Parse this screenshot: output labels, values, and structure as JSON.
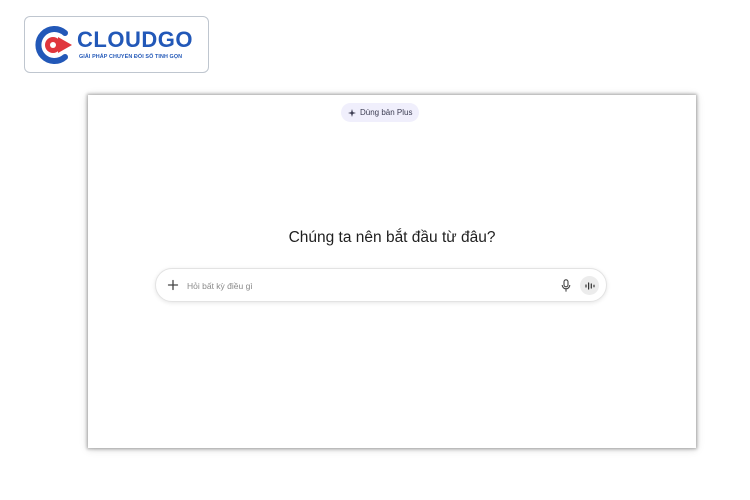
{
  "brand": {
    "name": "CLOUDGO",
    "tagline": "GIẢI PHÁP CHUYỂN ĐỔI SỐ TINH GỌN",
    "primary_color": "#2258b8",
    "accent_color": "#e0363d"
  },
  "chat": {
    "upgrade_label": "Dùng bản Plus",
    "headline": "Chúng ta nên bắt đầu từ đâu?",
    "input_placeholder": "Hỏi bất kỳ điều gì",
    "input_value": ""
  },
  "icons": {
    "upgrade": "sparkle-icon",
    "attach": "plus-icon",
    "dictate": "microphone-icon",
    "voice": "voice-wave-icon"
  }
}
